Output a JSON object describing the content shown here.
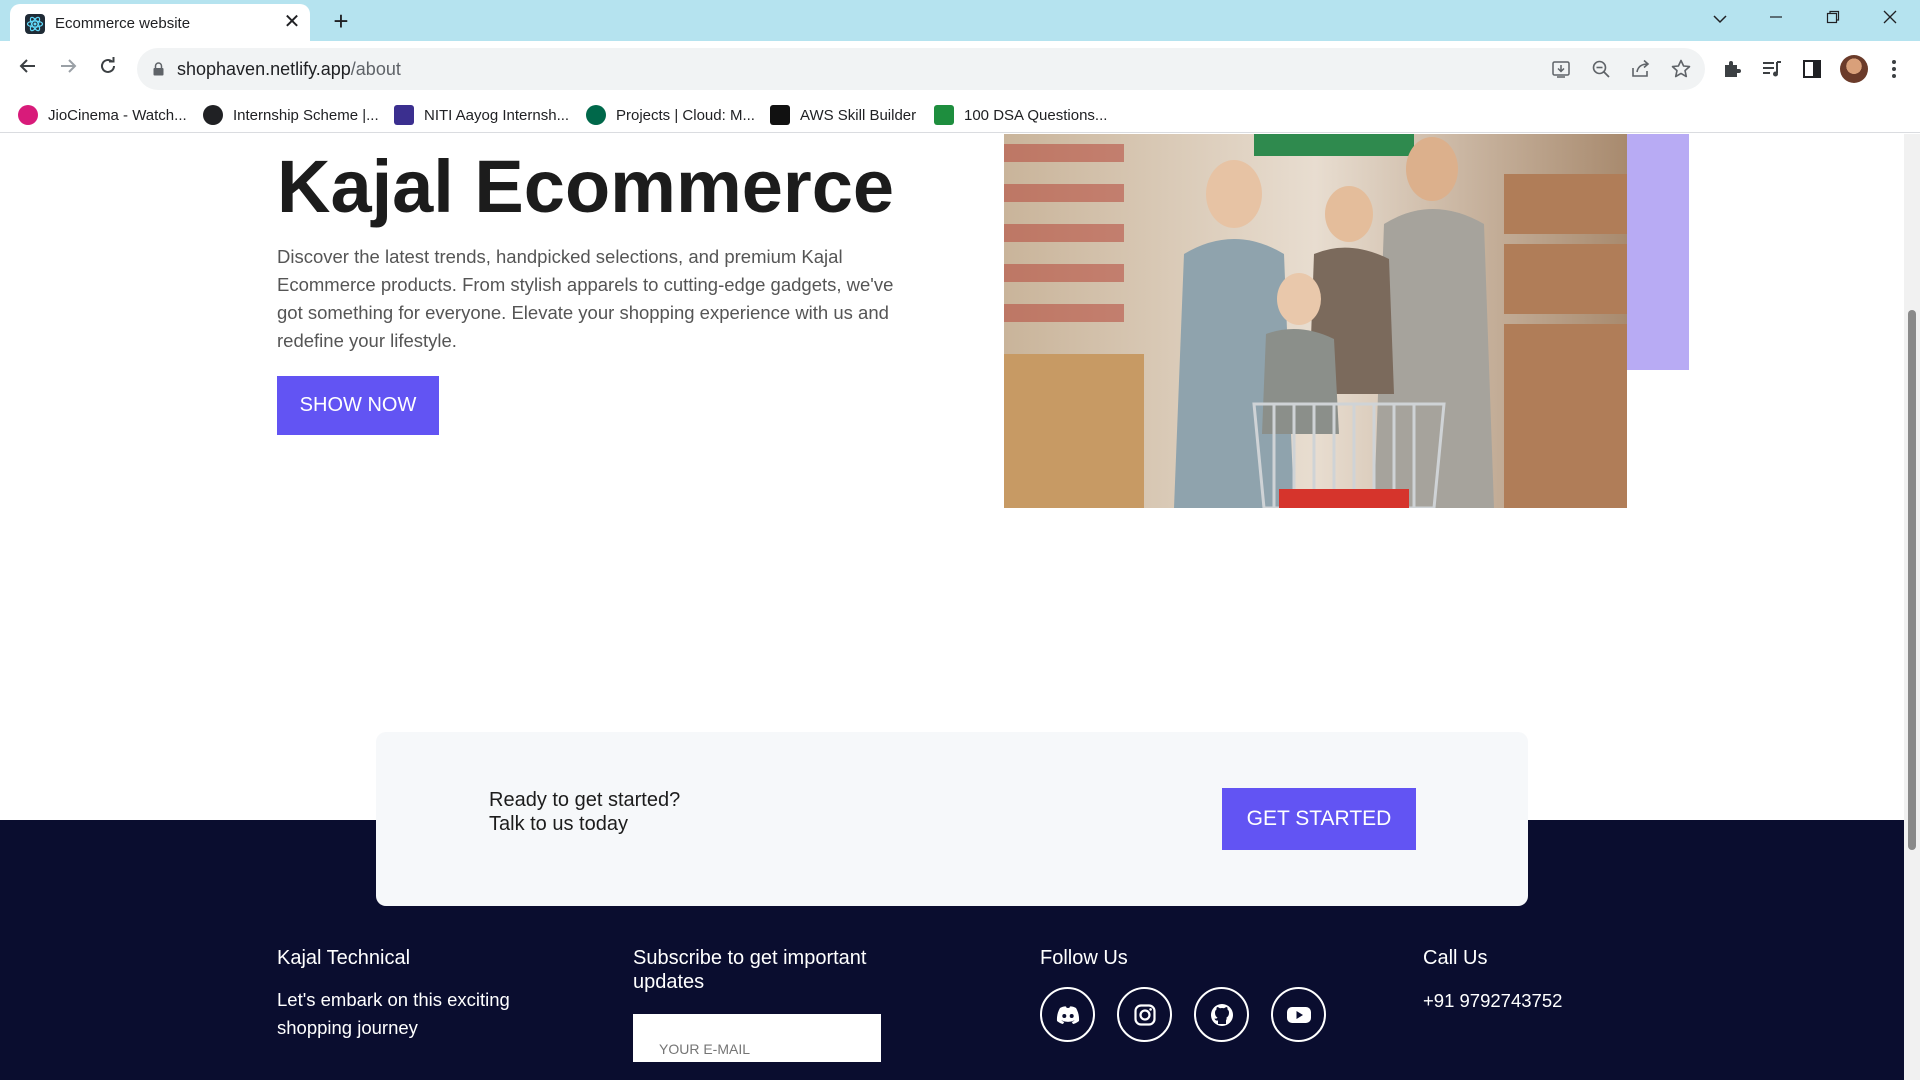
{
  "browser": {
    "tab_title": "Ecommerce website",
    "url_host": "shophaven.netlify.app",
    "url_path": "/about",
    "bookmarks": [
      {
        "label": "JioCinema - Watch...",
        "icon": "jiocinema-icon",
        "color": "#d81b7a"
      },
      {
        "label": "Internship Scheme |...",
        "icon": "globe-icon",
        "color": "#202124"
      },
      {
        "label": "NITI Aayog Internsh...",
        "icon": "niti-icon",
        "color": "#3b2f8f"
      },
      {
        "label": "Projects | Cloud: M...",
        "icon": "mongodb-icon",
        "color": "#00684a"
      },
      {
        "label": "AWS Skill Builder",
        "icon": "aws-icon",
        "color": "#111111"
      },
      {
        "label": "100 DSA Questions...",
        "icon": "sheets-icon",
        "color": "#1e8e3e"
      }
    ]
  },
  "hero": {
    "title": "Kajal Ecommerce",
    "description": "Discover the latest trends, handpicked selections, and premium Kajal Ecommerce products. From stylish apparels to cutting-edge gadgets, we've got something for everyone. Elevate your shopping experience with us and redefine your lifestyle.",
    "button_label": "SHOW NOW",
    "image": "family-shopping-cart-photo"
  },
  "cta": {
    "line1": "Ready to get started?",
    "line2": "Talk to us today",
    "button_label": "GET STARTED"
  },
  "footer": {
    "brand_title": "Kajal Technical",
    "brand_text": "Let's embark on this exciting shopping journey",
    "subscribe_title": "Subscribe to get important updates",
    "email_placeholder": "YOUR E-MAIL",
    "follow_title": "Follow Us",
    "socials": [
      "discord-icon",
      "instagram-icon",
      "github-icon",
      "youtube-icon"
    ],
    "call_title": "Call Us",
    "phone": "+91 9792743752"
  },
  "colors": {
    "accent": "#6254f3",
    "accent_light": "#b8abf4",
    "footer_bg": "#0a0d2f",
    "tabbar_bg": "#b5e3ef"
  }
}
